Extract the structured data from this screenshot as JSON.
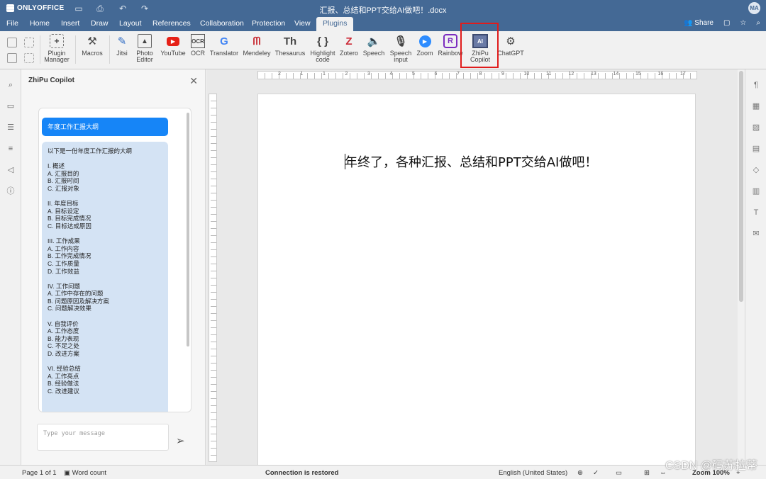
{
  "app": {
    "logo_text": "ONLYOFFICE",
    "doc_title": "汇报、总结和PPT交给AI做吧！.docx",
    "avatar": "MA"
  },
  "menu": {
    "tabs": [
      "File",
      "Home",
      "Insert",
      "Draw",
      "Layout",
      "References",
      "Collaboration",
      "Protection",
      "View",
      "Plugins"
    ],
    "active_tab": "Plugins",
    "share_label": "Share"
  },
  "toolbar": {
    "plugin_manager": "Plugin\nManager",
    "macros": "Macros",
    "jitsi": "Jitsi",
    "photo_editor": "Photo\nEditor",
    "youtube": "YouTube",
    "ocr": "OCR",
    "translator": "Translator",
    "mendeley": "Mendeley",
    "thesaurus": "Thesaurus",
    "highlight_code": "Highlight\ncode",
    "zotero": "Zotero",
    "speech": "Speech",
    "speech_input": "Speech\ninput",
    "zoom": "Zoom",
    "rainbow": "Rainbow",
    "zhipu_copilot": "ZhiPu\nCopilot",
    "chatgpt": "ChatGPT"
  },
  "panel": {
    "title": "ZhiPu Copilot",
    "user_message": "年度工作汇报大纲",
    "ai_response": "以下是一份年度工作汇报的大纲\n\nI. 概述\nA. 汇报目的\nB. 汇报时间\nC. 汇报对象\n\nII. 年度目标\nA. 目标设定\nB. 目标完成情况\nC. 目标达成原因\n\nIII. 工作成果\nA. 工作内容\nB. 工作完成情况\nC. 工作质量\nD. 工作效益\n\nIV. 工作问题\nA. 工作中存在的问题\nB. 问题原因及解决方案\nC. 问题解决效果\n\nV. 自我评价\nA. 工作态度\nB. 能力表现\nC. 不足之处\nD. 改进方案\n\nVI. 经验总结\nA. 工作亮点\nB. 经验做法\nC. 改进建议",
    "input_placeholder": "Type your message"
  },
  "document": {
    "text": "年终了，各种汇报、总结和PPT交给AI做吧！"
  },
  "ruler": {
    "marks": [
      "2",
      "1",
      "1",
      "2",
      "3",
      "4",
      "5",
      "6",
      "7",
      "8",
      "9",
      "10",
      "11",
      "12",
      "13",
      "14",
      "15",
      "16",
      "17"
    ]
  },
  "status": {
    "page": "Page 1 of 1",
    "word_count": "Word count",
    "connection": "Connection is restored",
    "language": "English (United States)",
    "zoom": "Zoom 100%"
  },
  "watermark": "CSDN @码苏拉蒂"
}
